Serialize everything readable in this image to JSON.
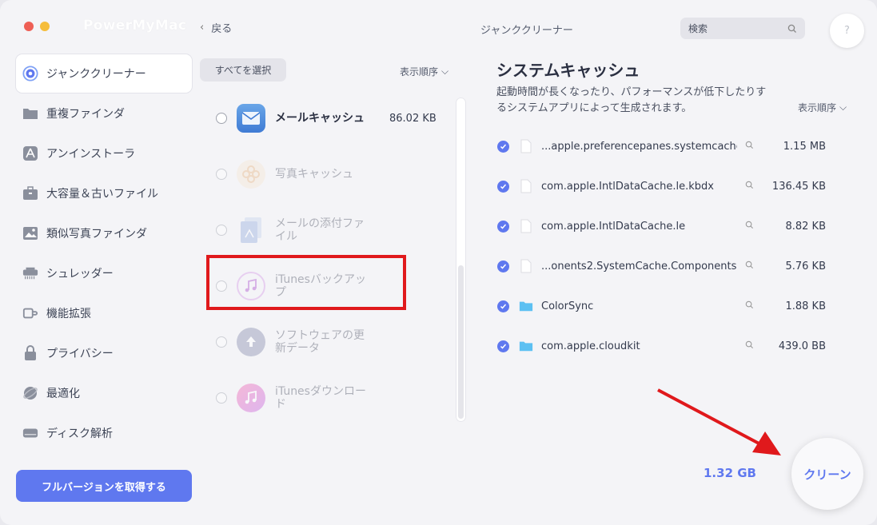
{
  "app": {
    "title": "PowerMyMac"
  },
  "toolbar": {
    "back_label": "戻る",
    "center_title": "ジャンククリーナー",
    "search_placeholder": "検索",
    "help_label": "?"
  },
  "sidebar": {
    "items": [
      {
        "label": "ジャンククリーナー",
        "icon": "junk-cleaner-icon",
        "active": true
      },
      {
        "label": "重複ファインダ",
        "icon": "folder-icon"
      },
      {
        "label": "アンインストーラ",
        "icon": "app-store-icon"
      },
      {
        "label": "大容量＆古いファイル",
        "icon": "briefcase-icon"
      },
      {
        "label": "類似写真ファインダ",
        "icon": "photo-icon"
      },
      {
        "label": "シュレッダー",
        "icon": "shredder-icon"
      },
      {
        "label": "機能拡張",
        "icon": "extension-icon"
      },
      {
        "label": "プライバシー",
        "icon": "lock-icon"
      },
      {
        "label": "最適化",
        "icon": "optimize-icon"
      },
      {
        "label": "ディスク解析",
        "icon": "disk-icon"
      }
    ],
    "upgrade_label": "フルバージョンを取得する"
  },
  "middle": {
    "select_all_label": "すべてを選択",
    "sort_label": "表示順序",
    "categories": [
      {
        "name": "メールキャッシュ",
        "size": "86.02 KB",
        "icon": "mail-icon"
      },
      {
        "name": "写真キャッシュ",
        "size": "",
        "icon": "photos-icon"
      },
      {
        "name": "メールの添付ファイル",
        "size": "",
        "icon": "attachment-icon"
      },
      {
        "name": "iTunesバックアップ",
        "size": "",
        "icon": "itunes-backup-icon"
      },
      {
        "name": "ソフトウェアの更新データ",
        "size": "",
        "icon": "software-update-icon"
      },
      {
        "name": "iTunesダウンロード",
        "size": "",
        "icon": "itunes-download-icon"
      }
    ]
  },
  "detail": {
    "title": "システムキャッシュ",
    "description": "起動時間が長くなったり、パフォーマンスが低下したりするシステムアプリによって生成されます。",
    "sort_label": "表示順序",
    "files": [
      {
        "name": "...apple.preferencepanes.systemcache",
        "size": "1.15 MB",
        "type": "file"
      },
      {
        "name": "com.apple.IntlDataCache.le.kbdx",
        "size": "136.45 KB",
        "type": "file"
      },
      {
        "name": "com.apple.IntlDataCache.le",
        "size": "8.82 KB",
        "type": "file"
      },
      {
        "name": "...onents2.SystemCache.Components",
        "size": "5.76 KB",
        "type": "file"
      },
      {
        "name": "ColorSync",
        "size": "1.88 KB",
        "type": "folder"
      },
      {
        "name": "com.apple.cloudkit",
        "size": "439.0 BB",
        "type": "folder"
      }
    ],
    "total": "1.32 GB",
    "clean_label": "クリーン"
  },
  "colors": {
    "accent": "#5f78ef",
    "highlight": "#e0191c"
  }
}
